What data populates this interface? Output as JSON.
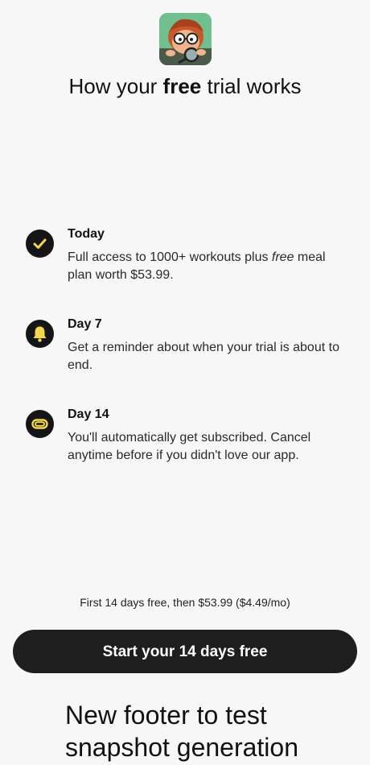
{
  "header": {
    "title_before": "How your ",
    "title_emphasis": "free",
    "title_after": " trial works",
    "app_icon": "cartoon-character-magnifier-icon"
  },
  "timeline": {
    "items": [
      {
        "icon": "checkmark-icon",
        "heading": "Today",
        "description_before": "Full access to 1000+ workouts plus ",
        "description_emphasis": "free",
        "description_after": " meal plan worth $53.99."
      },
      {
        "icon": "bell-icon",
        "heading": "Day 7",
        "description": "Get a reminder about when your trial is about to end."
      },
      {
        "icon": "paperclip-icon",
        "heading": "Day 14",
        "description": "You'll automatically get subscribed. Cancel anytime before if you didn't love our app."
      }
    ],
    "accent_color": "#f2d84b",
    "icon_background": "#151515"
  },
  "pricing": {
    "note": "First 14 days free, then $53.99 ($4.49/mo)"
  },
  "cta": {
    "label": "Start your 14 days free",
    "background": "#1e1e1e"
  },
  "footer": {
    "text": "New footer to test snapshot generation"
  }
}
